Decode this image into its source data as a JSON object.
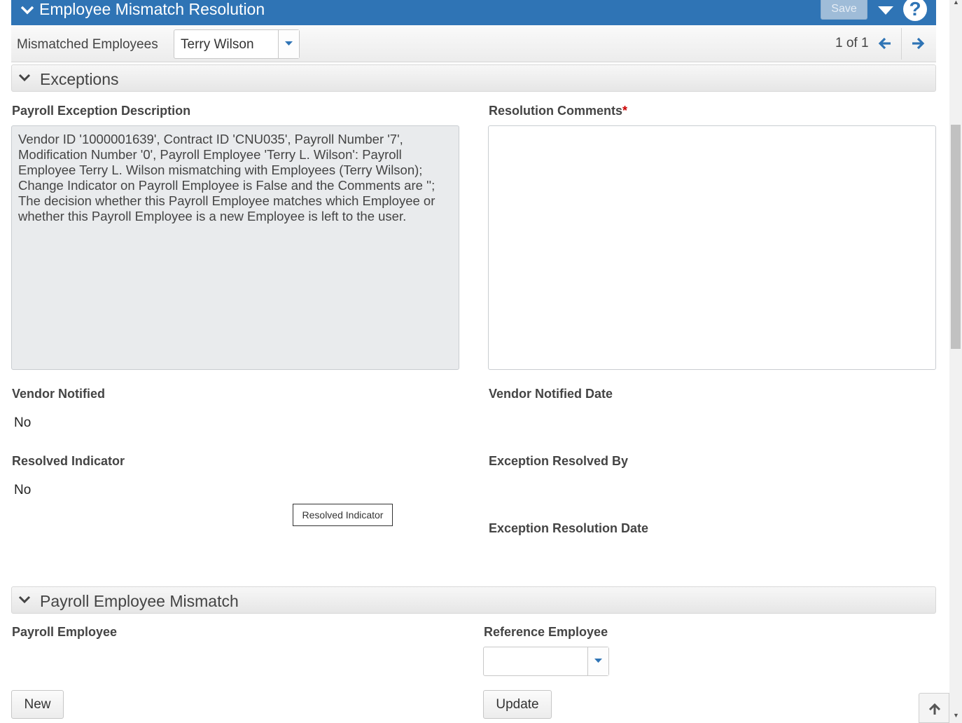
{
  "header": {
    "title": "Employee Mismatch Resolution",
    "save_label": "Save",
    "help_label": "?"
  },
  "navbar": {
    "label": "Mismatched Employees",
    "selected_employee": "Terry Wilson",
    "record_count": "1 of 1"
  },
  "exceptions": {
    "section_title": "Exceptions",
    "description_label": "Payroll Exception Description",
    "description_text": "Vendor ID '1000001639', Contract ID 'CNU035', Payroll Number '7', Modification Number '0', Payroll Employee 'Terry L. Wilson': Payroll Employee Terry L. Wilson mismatching with Employees (Terry Wilson); Change Indicator on Payroll Employee is False and the Comments are ''; The decision whether this Payroll Employee matches which Employee or whether this Payroll Employee is a new Employee is left to the user.",
    "comments_label": "Resolution Comments",
    "required_mark": "*",
    "comments_value": "",
    "vendor_notified_label": "Vendor Notified",
    "vendor_notified_value": "No",
    "vendor_notified_date_label": "Vendor Notified Date",
    "resolved_indicator_label": "Resolved Indicator",
    "resolved_indicator_value": "No",
    "resolved_by_label": "Exception Resolved By",
    "resolution_date_label": "Exception Resolution Date",
    "tooltip": "Resolved Indicator"
  },
  "mismatch": {
    "section_title": "Payroll Employee Mismatch",
    "payroll_employee_label": "Payroll Employee",
    "reference_employee_label": "Reference Employee",
    "reference_employee_value": "",
    "new_button": "New",
    "update_button": "Update"
  },
  "colors": {
    "header_bg": "#2f74b5",
    "required": "#cc0000",
    "nav_arrow": "#2f74b5"
  }
}
